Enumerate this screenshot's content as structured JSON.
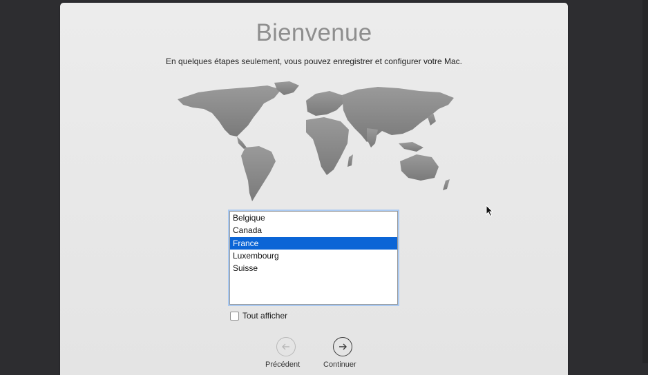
{
  "window": {
    "title": "Bienvenue",
    "subtitle": "En quelques étapes seulement, vous pouvez enregistrer et configurer votre Mac."
  },
  "country_list": {
    "items": [
      "Belgique",
      "Canada",
      "France",
      "Luxembourg",
      "Suisse"
    ],
    "selected": "France"
  },
  "show_all": {
    "label": "Tout afficher",
    "checked": false
  },
  "navigation": {
    "back_label": "Précédent",
    "next_label": "Continuer"
  },
  "colors": {
    "selection": "#0b65d6",
    "title": "#8e8e8e",
    "map": "#8c8c8c"
  }
}
